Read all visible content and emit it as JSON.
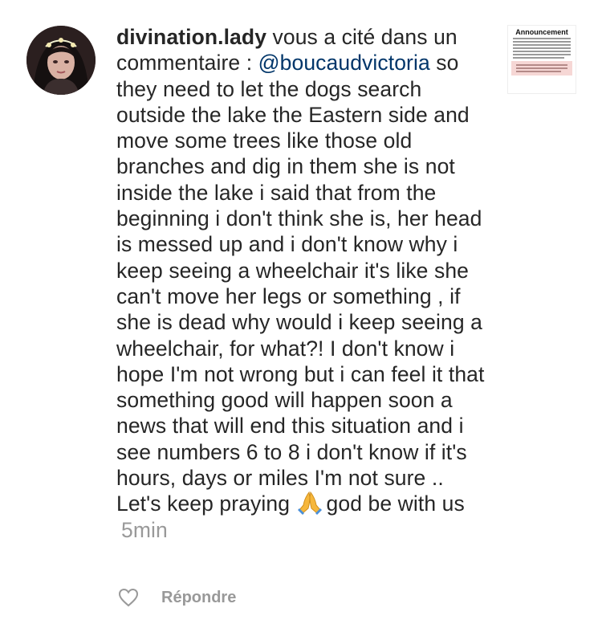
{
  "comment": {
    "username": "divination.lady",
    "intro": "vous a cité dans un commentaire :",
    "mention": "@boucaudvictoria",
    "text_before_emoji": "so they need to let the dogs search outside the lake the Eastern side and move some trees like those old branches and dig in them she is not inside the lake i said that from the beginning i don't think she is, her head is messed up and i don't know why i keep seeing a wheelchair it's like she can't move her legs or something , if she is dead why would i keep seeing a wheelchair, for what?! I don't know i hope I'm not wrong but i can feel it that something good will happen soon a news that will end this situation and i see numbers 6 to 8 i don't know if it's hours, days or miles I'm not sure .. Let's keep praying",
    "emoji": "praying-hands-emoji",
    "text_after_emoji": "god be with us",
    "time": "5min"
  },
  "post_thumbnail": {
    "title": "Announcement"
  },
  "actions": {
    "like_icon": "heart-icon",
    "reply_label": "Répondre"
  }
}
